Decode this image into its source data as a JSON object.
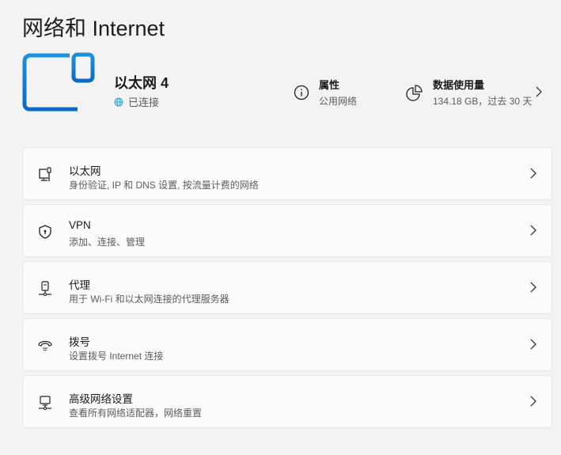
{
  "page_title": "网络和 Internet",
  "connection": {
    "name": "以太网 4",
    "status": "已连接"
  },
  "properties": {
    "title": "属性",
    "value": "公用网络"
  },
  "data_usage": {
    "title": "数据使用量",
    "value": "134.18 GB，过去 30 天"
  },
  "items": [
    {
      "label": "以太网",
      "sub": "身份验证, IP 和 DNS 设置, 按流量计费的网络"
    },
    {
      "label": "VPN",
      "sub": "添加、连接、管理"
    },
    {
      "label": "代理",
      "sub": "用于 Wi-Fi 和以太网连接的代理服务器"
    },
    {
      "label": "拨号",
      "sub": "设置拨号 Internet 连接"
    },
    {
      "label": "高级网络设置",
      "sub": "查看所有网络适配器，网络重置"
    }
  ]
}
